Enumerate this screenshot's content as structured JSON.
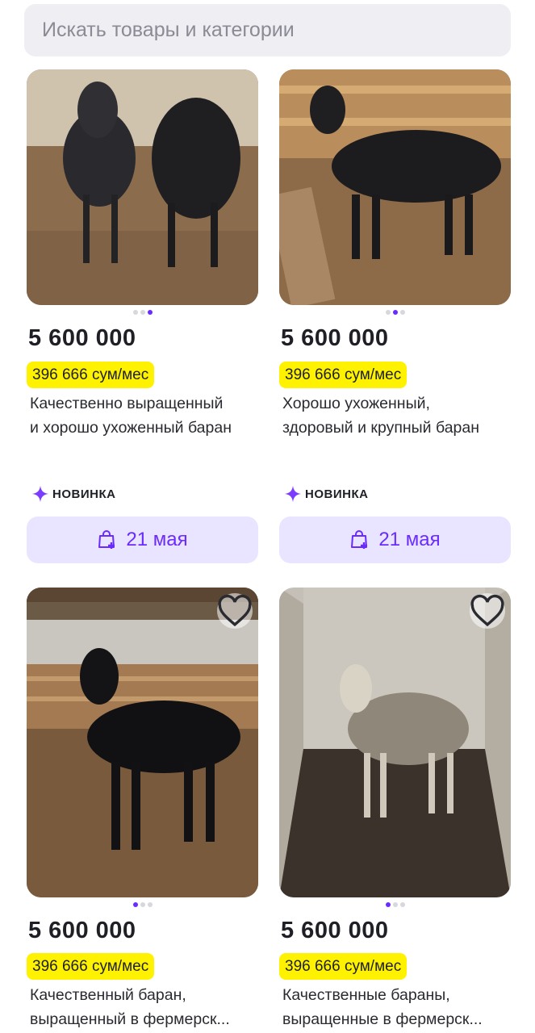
{
  "search": {
    "placeholder": "Искать товары и категории"
  },
  "colors": {
    "accent": "#6b2bff",
    "installment_bg": "#fff200",
    "delivery_bg": "#e9e4ff"
  },
  "products": [
    {
      "price": "5 600 000",
      "installment": "396 666 сум/мес",
      "title_lines": [
        "Качественно выращенный",
        "и хорошо ухоженный баран"
      ],
      "badge": "НОВИНКА",
      "delivery": "21 мая",
      "image_dots": 3,
      "active_dot": 3
    },
    {
      "price": "5 600 000",
      "installment": "396 666 сум/мес",
      "title_lines": [
        "Хорошо ухоженный,",
        "здоровый и крупный баран"
      ],
      "badge": "НОВИНКА",
      "delivery": "21 мая",
      "image_dots": 3,
      "active_dot": 2
    },
    {
      "price": "5 600 000",
      "installment": "396 666 сум/мес",
      "title_lines": [
        "Качественный баран,",
        "выращенный в фермерск..."
      ],
      "image_dots": 3,
      "active_dot": 1
    },
    {
      "price": "5 600 000",
      "installment": "396 666 сум/мес",
      "title_lines": [
        "Качественные бараны,",
        "выращенные в фермерск..."
      ],
      "image_dots": 3,
      "active_dot": 1
    }
  ]
}
